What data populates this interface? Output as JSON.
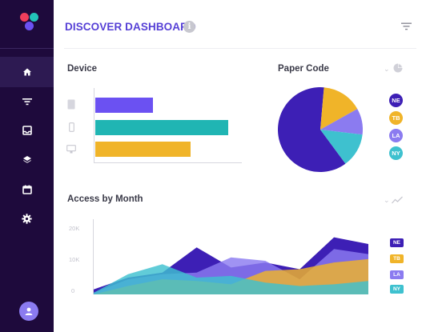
{
  "header": {
    "title": "DISCOVER DASHBOARD",
    "info_label": "i"
  },
  "sidebar": {
    "items": [
      {
        "icon": "home-icon",
        "active": true
      },
      {
        "icon": "filter-icon",
        "active": false
      },
      {
        "icon": "inbox-icon",
        "active": false
      },
      {
        "icon": "layers-icon",
        "active": false
      },
      {
        "icon": "calendar-icon",
        "active": false
      },
      {
        "icon": "settings-icon",
        "active": false
      }
    ],
    "avatar_icon": "user-icon"
  },
  "device_section": {
    "title": "Device"
  },
  "paper_section": {
    "title": "Paper Code"
  },
  "access_section": {
    "title": "Access by Month"
  },
  "colors": {
    "sidebar": "#1e0a3c",
    "accent": "#5640d6",
    "NE": "#3d1fb5",
    "TB": "#f0b429",
    "LA": "#8b7bf0",
    "NY": "#3ec1cf",
    "bar_purple": "#6b51f2",
    "bar_teal": "#20b5b3",
    "bar_yellow": "#f0b429"
  },
  "chart_data": [
    {
      "type": "bar",
      "orientation": "horizontal",
      "title": "Device",
      "categories": [
        "tablet",
        "mobile",
        "desktop"
      ],
      "values": [
        0.41,
        0.95,
        0.68
      ],
      "bar_colors": [
        "#6b51f2",
        "#20b5b3",
        "#f0b429"
      ],
      "xlim": [
        0,
        1
      ],
      "grid": false
    },
    {
      "type": "pie",
      "title": "Paper Code",
      "slices": [
        {
          "label": "NE",
          "value": 0.615,
          "color": "#3d1fb5"
        },
        {
          "label": "TB",
          "value": 0.155,
          "color": "#f0b429"
        },
        {
          "label": "LA",
          "value": 0.1,
          "color": "#8b7bf0"
        },
        {
          "label": "NY",
          "value": 0.13,
          "color": "#3ec1cf"
        }
      ],
      "legend": [
        "NE",
        "TB",
        "LA",
        "NY"
      ],
      "legend_position": "right"
    },
    {
      "type": "area",
      "title": "Access by Month",
      "y_ticks": [
        "20K",
        "10K",
        "0"
      ],
      "ylim": [
        0,
        20000
      ],
      "x": [
        0,
        1,
        2,
        3,
        4,
        5,
        6,
        7,
        8
      ],
      "series": [
        {
          "name": "NE",
          "color": "#3d1fb5",
          "values": [
            1500,
            5000,
            6500,
            14000,
            8000,
            9500,
            7500,
            17000,
            15000
          ]
        },
        {
          "name": "LA",
          "color": "#8b7bf0",
          "values": [
            500,
            4500,
            6000,
            6500,
            11000,
            10000,
            4500,
            13500,
            12000
          ]
        },
        {
          "name": "TB",
          "color": "#f0b429",
          "values": [
            0,
            2500,
            4500,
            4000,
            3000,
            7000,
            7500,
            9500,
            10500
          ]
        },
        {
          "name": "NY",
          "color": "#3ec1cf",
          "values": [
            500,
            6000,
            9000,
            5000,
            5500,
            3500,
            2500,
            3000,
            4000
          ]
        }
      ],
      "legend": [
        "NE",
        "TB",
        "LA",
        "NY"
      ],
      "legend_position": "right",
      "grid": false
    }
  ]
}
